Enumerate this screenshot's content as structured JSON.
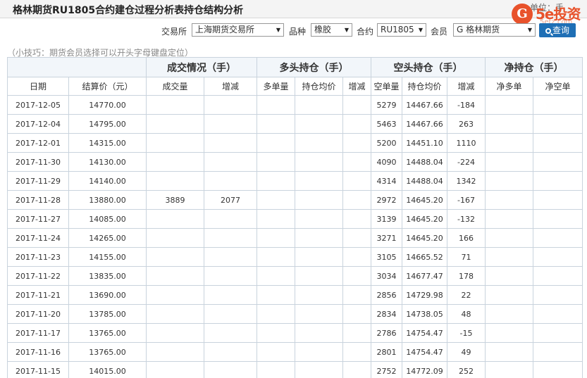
{
  "header": {
    "title": "格林期货RU1805合约建仓过程分析表持仓结构分析",
    "unit": "单位：手"
  },
  "logo": {
    "mark": "G",
    "brand": "5e投资",
    "url": "5etz.com"
  },
  "filters": {
    "exchange_label": "交易所",
    "exchange_value": "上海期货交易所",
    "product_label": "品种",
    "product_value": "橡胶",
    "contract_label": "合约",
    "contract_value": "RU1805",
    "member_label": "会员",
    "member_value": "G 格林期货",
    "query_label": "查询"
  },
  "tip": "（小技巧：期货会员选择可以开头字母键盘定位）",
  "table": {
    "groups": [
      "成交情况（手）",
      "多头持仓（手）",
      "空头持仓（手）",
      "净持仓（手）"
    ],
    "columns": [
      "日期",
      "结算价（元）",
      "成交量",
      "增减",
      "多单量",
      "持仓均价",
      "增减",
      "空单量",
      "持仓均价",
      "增减",
      "净多单",
      "净空单"
    ],
    "rows": [
      {
        "date": "2017-12-05",
        "price": "14770.00",
        "vol": "",
        "vchg": "",
        "short": "5279",
        "savg": "14467.66",
        "schg": "-184"
      },
      {
        "date": "2017-12-04",
        "price": "14795.00",
        "vol": "",
        "vchg": "",
        "short": "5463",
        "savg": "14467.66",
        "schg": "263"
      },
      {
        "date": "2017-12-01",
        "price": "14315.00",
        "vol": "",
        "vchg": "",
        "short": "5200",
        "savg": "14451.10",
        "schg": "1110"
      },
      {
        "date": "2017-11-30",
        "price": "14130.00",
        "vol": "",
        "vchg": "",
        "short": "4090",
        "savg": "14488.04",
        "schg": "-224"
      },
      {
        "date": "2017-11-29",
        "price": "14140.00",
        "vol": "",
        "vchg": "",
        "short": "4314",
        "savg": "14488.04",
        "schg": "1342"
      },
      {
        "date": "2017-11-28",
        "price": "13880.00",
        "vol": "3889",
        "vchg": "2077",
        "short": "2972",
        "savg": "14645.20",
        "schg": "-167"
      },
      {
        "date": "2017-11-27",
        "price": "14085.00",
        "vol": "",
        "vchg": "",
        "short": "3139",
        "savg": "14645.20",
        "schg": "-132"
      },
      {
        "date": "2017-11-24",
        "price": "14265.00",
        "vol": "",
        "vchg": "",
        "short": "3271",
        "savg": "14645.20",
        "schg": "166"
      },
      {
        "date": "2017-11-23",
        "price": "14155.00",
        "vol": "",
        "vchg": "",
        "short": "3105",
        "savg": "14665.52",
        "schg": "71"
      },
      {
        "date": "2017-11-22",
        "price": "13835.00",
        "vol": "",
        "vchg": "",
        "short": "3034",
        "savg": "14677.47",
        "schg": "178"
      },
      {
        "date": "2017-11-21",
        "price": "13690.00",
        "vol": "",
        "vchg": "",
        "short": "2856",
        "savg": "14729.98",
        "schg": "22"
      },
      {
        "date": "2017-11-20",
        "price": "13785.00",
        "vol": "",
        "vchg": "",
        "short": "2834",
        "savg": "14738.05",
        "schg": "48"
      },
      {
        "date": "2017-11-17",
        "price": "13765.00",
        "vol": "",
        "vchg": "",
        "short": "2786",
        "savg": "14754.47",
        "schg": "-15"
      },
      {
        "date": "2017-11-16",
        "price": "13765.00",
        "vol": "",
        "vchg": "",
        "short": "2801",
        "savg": "14754.47",
        "schg": "49"
      },
      {
        "date": "2017-11-15",
        "price": "14015.00",
        "vol": "",
        "vchg": "",
        "short": "2752",
        "savg": "14772.09",
        "schg": "252"
      }
    ]
  },
  "colors": {
    "positive": "#e00000",
    "negative": "#008000",
    "accent": "#1f6fb5",
    "brand": "#e8522b"
  }
}
